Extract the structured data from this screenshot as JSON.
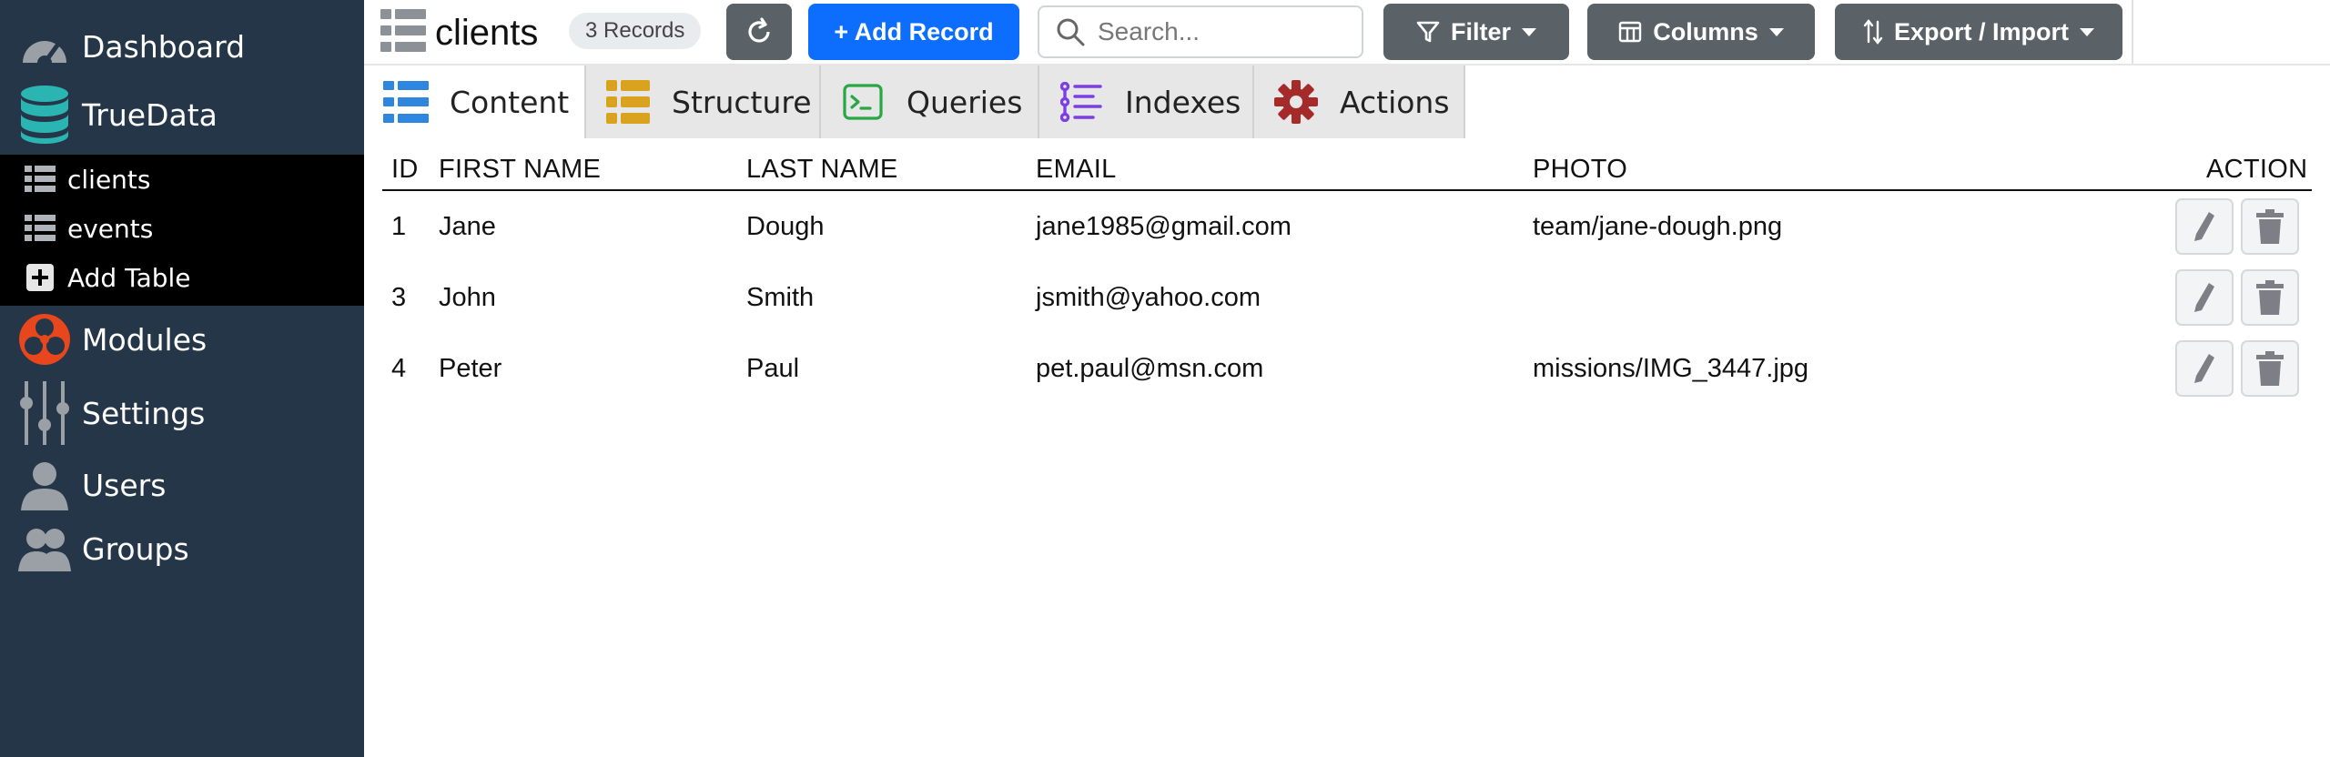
{
  "sidebar": {
    "items": [
      {
        "label": "Dashboard",
        "icon": "speedometer-icon"
      },
      {
        "label": "TrueData",
        "icon": "database-icon"
      },
      {
        "label": "Modules",
        "icon": "modules-icon"
      },
      {
        "label": "Settings",
        "icon": "sliders-icon"
      },
      {
        "label": "Users",
        "icon": "user-icon"
      },
      {
        "label": "Groups",
        "icon": "users-icon"
      }
    ],
    "tables": [
      {
        "label": "clients",
        "icon": "table-icon"
      },
      {
        "label": "events",
        "icon": "table-icon"
      },
      {
        "label": "Add Table",
        "icon": "plus-square-icon"
      }
    ]
  },
  "header": {
    "title": "clients",
    "records_badge": "3 Records",
    "add_label": "+ Add Record",
    "search_placeholder": "Search...",
    "filter_label": "Filter",
    "columns_label": "Columns",
    "export_label": "Export / Import"
  },
  "tabs": [
    {
      "label": "Content",
      "icon": "table-icon",
      "active": true
    },
    {
      "label": "Structure",
      "icon": "list-icon"
    },
    {
      "label": "Queries",
      "icon": "terminal-icon"
    },
    {
      "label": "Indexes",
      "icon": "list-ordered-icon"
    },
    {
      "label": "Actions",
      "icon": "gear-icon"
    }
  ],
  "table": {
    "columns": [
      "ID",
      "FIRST NAME",
      "LAST NAME",
      "EMAIL",
      "PHOTO",
      "ACTION"
    ],
    "rows": [
      {
        "id": "1",
        "first": "Jane",
        "last": "Dough",
        "email": "jane1985@gmail.com",
        "photo": "team/jane-dough.png"
      },
      {
        "id": "3",
        "first": "John",
        "last": "Smith",
        "email": "jsmith@yahoo.com",
        "photo": ""
      },
      {
        "id": "4",
        "first": "Peter",
        "last": "Paul",
        "email": "pet.paul@msn.com",
        "photo": "missions/IMG_3447.jpg"
      }
    ]
  },
  "colors": {
    "sidebar_bg": "#243648",
    "primary": "#0d6efd",
    "secondary": "#5a6268",
    "database_teal": "#2bb5b2",
    "modules_orange": "#e8461c",
    "structure_gold": "#d9a320",
    "queries_green": "#28a745",
    "indexes_purple": "#7b3fe4",
    "actions_red": "#a52a2a",
    "content_blue": "#2e86de"
  }
}
